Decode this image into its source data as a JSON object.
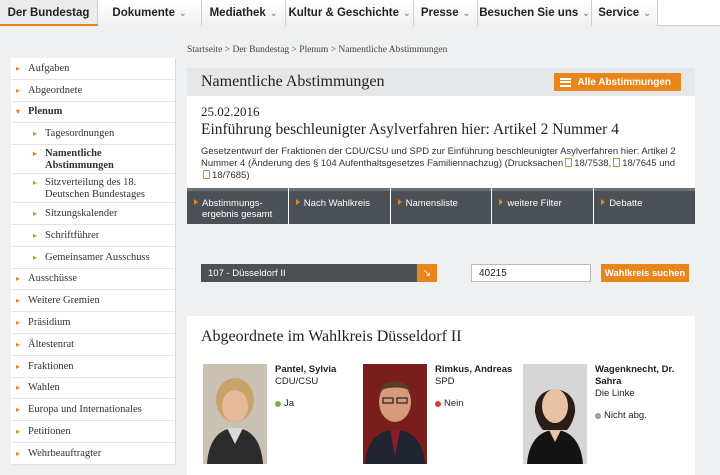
{
  "topnav": {
    "items": [
      {
        "label": "Der Bundestag"
      },
      {
        "label": "Dokumente"
      },
      {
        "label": "Mediathek"
      },
      {
        "label": "Kultur & Geschichte"
      },
      {
        "label": "Presse"
      },
      {
        "label": "Besuchen Sie uns"
      },
      {
        "label": "Service"
      }
    ]
  },
  "sidebar": {
    "items": [
      {
        "label": "Aufgaben"
      },
      {
        "label": "Abgeordnete"
      },
      {
        "label": "Plenum"
      },
      {
        "label": "Tagesordnungen"
      },
      {
        "label": "Namentliche Abstimmungen"
      },
      {
        "label": "Sitzverteilung des 18. Deutschen Bundestages"
      },
      {
        "label": "Sitzungskalender"
      },
      {
        "label": "Schriftführer"
      },
      {
        "label": "Gemeinsamer Ausschuss"
      },
      {
        "label": "Ausschüsse"
      },
      {
        "label": "Weitere Gremien"
      },
      {
        "label": "Präsidium"
      },
      {
        "label": "Ältestenrat"
      },
      {
        "label": "Fraktionen"
      },
      {
        "label": "Wahlen"
      },
      {
        "label": "Europa und Internationales"
      },
      {
        "label": "Petitionen"
      },
      {
        "label": "Wehrbeauftragter"
      }
    ]
  },
  "breadcrumb": "Startseite > Der Bundestag > Plenum > Namentliche Abstimmungen",
  "page_title": "Namentliche Abstimmungen",
  "all_votes_label": "Alle Abstimmungen",
  "vote": {
    "date": "25.02.2016",
    "title": "Einführung beschleunigter Asylverfahren hier: Artikel 2 Nummer 4",
    "desc": "Gesetzentwurf der Fraktionen der CDU/CSU und SPD zur Einführung beschleunigter Asylverfahren hier: Artikel 2 Nummer 4 (Änderung des § 104 Aufenthaltsgesetzes Familiennachzug) (Drucksachen",
    "docs": [
      "18/7538",
      "18/7645",
      "18/7685"
    ],
    "sep1": ",",
    "sep2": "und",
    "close": ")"
  },
  "tabs": [
    {
      "label": "Abstimmungs-ergebnis gesamt"
    },
    {
      "label": "Nach Wahlkreis"
    },
    {
      "label": "Namensliste"
    },
    {
      "label": "weitere Filter"
    },
    {
      "label": "Debatte"
    }
  ],
  "filter": {
    "district_value": "107 - Düsseldorf II",
    "postal_value": "40215",
    "search_label": "Wahlkreis suchen"
  },
  "results": {
    "title": "Abgeordnete im Wahlkreis Düsseldorf II",
    "members": [
      {
        "name": "Pantel, Sylvia",
        "party": "CDU/CSU",
        "vote": "Ja",
        "vote_color": "#7cb342"
      },
      {
        "name": "Rimkus, Andreas",
        "party": "SPD",
        "vote": "Nein",
        "vote_color": "#e53935"
      },
      {
        "name": "Wagenknecht, Dr. Sahra",
        "party": "Die Linke",
        "vote": "Nicht abg.",
        "vote_color": "#9e9e9e"
      }
    ]
  },
  "colors": {
    "accent": "#e8861a",
    "dark": "#4b5156"
  }
}
